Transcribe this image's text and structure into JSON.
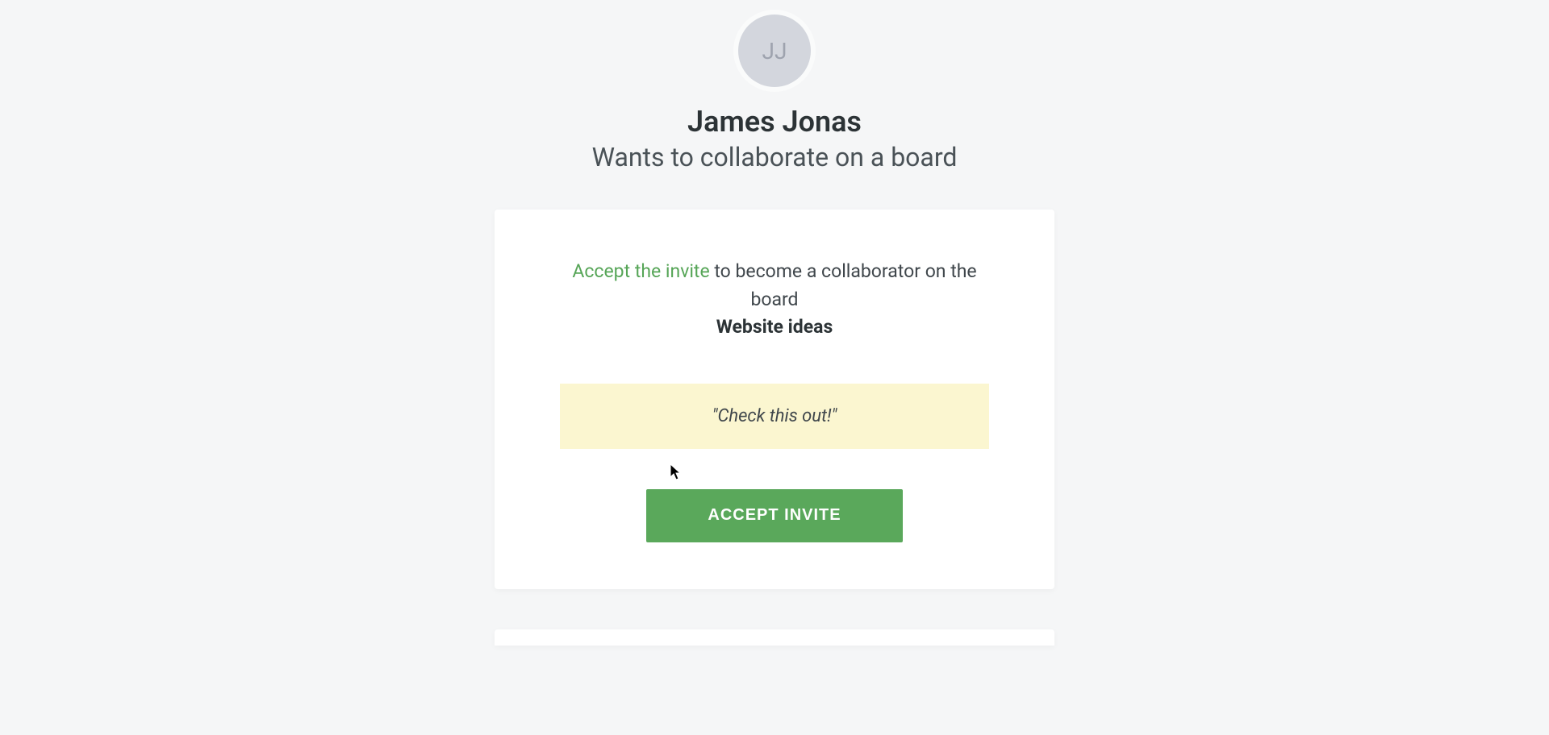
{
  "avatar": {
    "initials": "JJ"
  },
  "inviter": {
    "name": "James Jonas"
  },
  "subtitle": "Wants to collaborate on a board",
  "invite": {
    "accept_link_text": "Accept the invite",
    "description_suffix": " to become a collaborator on the board",
    "board_name": "Website ideas"
  },
  "message": "\"Check this out!\"",
  "button": {
    "accept_label": "ACCEPT INVITE"
  }
}
